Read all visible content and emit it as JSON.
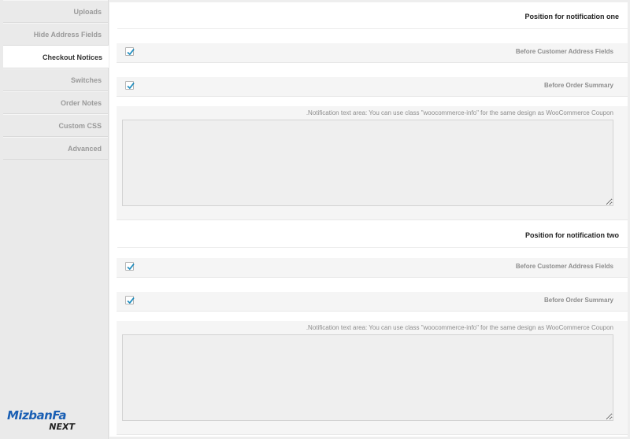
{
  "sidebar": {
    "items": [
      {
        "label": "Uploads",
        "active": false
      },
      {
        "label": "Hide Address Fields",
        "active": false
      },
      {
        "label": "Checkout Notices",
        "active": true
      },
      {
        "label": "Switches",
        "active": false
      },
      {
        "label": "Order Notes",
        "active": false
      },
      {
        "label": "Custom CSS",
        "active": false
      },
      {
        "label": "Advanced",
        "active": false
      }
    ]
  },
  "logo": {
    "line1": "MizbanFa",
    "line2": "NEXT",
    "color": "#1a5fb4"
  },
  "sections": [
    {
      "title": "Position for notification one",
      "options": [
        {
          "label": "Before Customer Address Fields",
          "checked": true
        },
        {
          "label": "Before Order Summary",
          "checked": true
        }
      ],
      "textarea_label": ".Notification text area: You can use class \"woocommerce-info\" for the same design as WooCommerce Coupon",
      "textarea_value": ""
    },
    {
      "title": "Position for notification two",
      "options": [
        {
          "label": "Before Customer Address Fields",
          "checked": true
        },
        {
          "label": "Before Order Summary",
          "checked": true
        }
      ],
      "textarea_label": ".Notification text area: You can use class \"woocommerce-info\" for the same design as WooCommerce Coupon",
      "textarea_value": ""
    }
  ],
  "colors": {
    "check": "#1e8cbe",
    "active_bg": "#ffffff",
    "sidebar_bg": "#eaeaea"
  }
}
